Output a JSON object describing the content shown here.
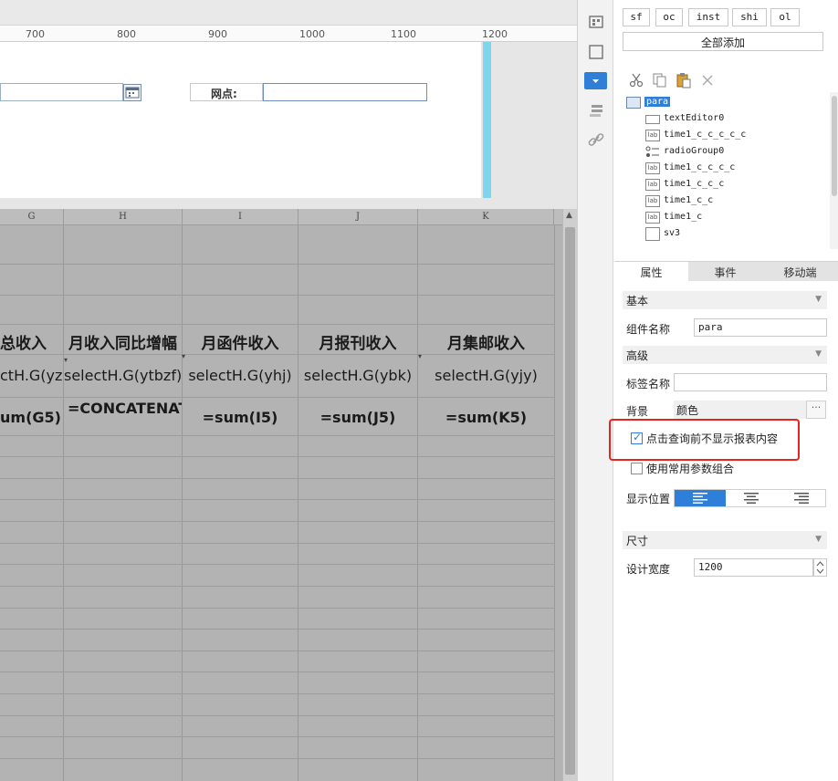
{
  "ruler": {
    "marks": [
      "700",
      "800",
      "900",
      "1000",
      "1100",
      "1200"
    ]
  },
  "params": {
    "net_label": "网点:"
  },
  "grid": {
    "col_headers": [
      "G",
      "H",
      "I",
      "J",
      "K"
    ],
    "titles": [
      "总收入",
      "月收入同比增幅",
      "月函件收入",
      "月报刊收入",
      "月集邮收入"
    ],
    "selects": [
      "ctH.G(yz)",
      "selectH.G(ytbzf)",
      "selectH.G(yhj)",
      "selectH.G(ybk)",
      "selectH.G(yjy)"
    ],
    "sums": [
      "um(G5)",
      "=CONCATENATE(ROUND((su",
      "=sum(I5)",
      "=sum(J5)",
      "=sum(K5)"
    ]
  },
  "query_buttons": [
    "sf",
    "oc",
    "inst",
    "shi",
    "ol"
  ],
  "add_all": "全部添加",
  "tree": {
    "nodes": [
      {
        "label": "para",
        "icon": "form-icon",
        "selected": true
      },
      {
        "label": "textEditor0",
        "icon": "text-editor-icon"
      },
      {
        "label": "time1_c_c_c_c_c",
        "icon": "label-icon",
        "icon_text": "lab"
      },
      {
        "label": "radioGroup0",
        "icon": "radio-group-icon"
      },
      {
        "label": "time1_c_c_c_c",
        "icon": "label-icon",
        "icon_text": "lab"
      },
      {
        "label": "time1_c_c_c",
        "icon": "label-icon",
        "icon_text": "lab"
      },
      {
        "label": "time1_c_c",
        "icon": "label-icon",
        "icon_text": "lab"
      },
      {
        "label": "time1_c",
        "icon": "label-icon",
        "icon_text": "lab"
      },
      {
        "label": "sv3",
        "icon": "date-icon"
      }
    ]
  },
  "tabs": [
    "属性",
    "事件",
    "移动端"
  ],
  "props": {
    "basic_section": "基本",
    "widget_name_label": "组件名称",
    "widget_name_value": "para",
    "advanced_section": "高级",
    "tag_name_label": "标签名称",
    "tag_name_value": "",
    "background_label": "背景",
    "background_value": "颜色",
    "background_more": "···",
    "no_show_before_query": "点击查询前不显示报表内容",
    "use_common_params": "使用常用参数组合",
    "display_position_label": "显示位置",
    "size_section": "尺寸",
    "design_width_label": "设计宽度",
    "design_width_value": "1200"
  },
  "colors": {
    "accent": "#2f7fd9",
    "highlight_box": "#e8241f",
    "guide": "#7fd5ee",
    "grid_bg": "#b3b3b3"
  }
}
